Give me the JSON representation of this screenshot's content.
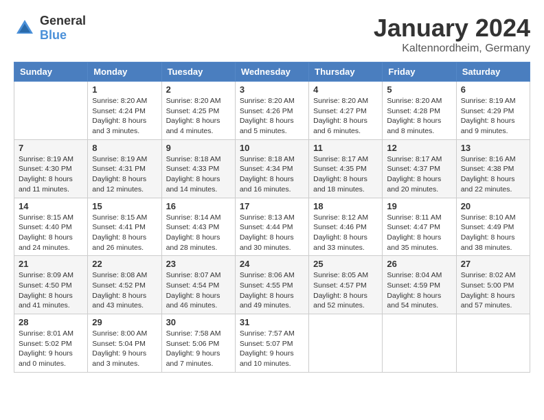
{
  "header": {
    "logo_general": "General",
    "logo_blue": "Blue",
    "month": "January 2024",
    "location": "Kaltennordheim, Germany"
  },
  "days_of_week": [
    "Sunday",
    "Monday",
    "Tuesday",
    "Wednesday",
    "Thursday",
    "Friday",
    "Saturday"
  ],
  "weeks": [
    {
      "shaded": false,
      "days": [
        {
          "number": "",
          "info": ""
        },
        {
          "number": "1",
          "info": "Sunrise: 8:20 AM\nSunset: 4:24 PM\nDaylight: 8 hours\nand 3 minutes."
        },
        {
          "number": "2",
          "info": "Sunrise: 8:20 AM\nSunset: 4:25 PM\nDaylight: 8 hours\nand 4 minutes."
        },
        {
          "number": "3",
          "info": "Sunrise: 8:20 AM\nSunset: 4:26 PM\nDaylight: 8 hours\nand 5 minutes."
        },
        {
          "number": "4",
          "info": "Sunrise: 8:20 AM\nSunset: 4:27 PM\nDaylight: 8 hours\nand 6 minutes."
        },
        {
          "number": "5",
          "info": "Sunrise: 8:20 AM\nSunset: 4:28 PM\nDaylight: 8 hours\nand 8 minutes."
        },
        {
          "number": "6",
          "info": "Sunrise: 8:19 AM\nSunset: 4:29 PM\nDaylight: 8 hours\nand 9 minutes."
        }
      ]
    },
    {
      "shaded": true,
      "days": [
        {
          "number": "7",
          "info": "Sunrise: 8:19 AM\nSunset: 4:30 PM\nDaylight: 8 hours\nand 11 minutes."
        },
        {
          "number": "8",
          "info": "Sunrise: 8:19 AM\nSunset: 4:31 PM\nDaylight: 8 hours\nand 12 minutes."
        },
        {
          "number": "9",
          "info": "Sunrise: 8:18 AM\nSunset: 4:33 PM\nDaylight: 8 hours\nand 14 minutes."
        },
        {
          "number": "10",
          "info": "Sunrise: 8:18 AM\nSunset: 4:34 PM\nDaylight: 8 hours\nand 16 minutes."
        },
        {
          "number": "11",
          "info": "Sunrise: 8:17 AM\nSunset: 4:35 PM\nDaylight: 8 hours\nand 18 minutes."
        },
        {
          "number": "12",
          "info": "Sunrise: 8:17 AM\nSunset: 4:37 PM\nDaylight: 8 hours\nand 20 minutes."
        },
        {
          "number": "13",
          "info": "Sunrise: 8:16 AM\nSunset: 4:38 PM\nDaylight: 8 hours\nand 22 minutes."
        }
      ]
    },
    {
      "shaded": false,
      "days": [
        {
          "number": "14",
          "info": "Sunrise: 8:15 AM\nSunset: 4:40 PM\nDaylight: 8 hours\nand 24 minutes."
        },
        {
          "number": "15",
          "info": "Sunrise: 8:15 AM\nSunset: 4:41 PM\nDaylight: 8 hours\nand 26 minutes."
        },
        {
          "number": "16",
          "info": "Sunrise: 8:14 AM\nSunset: 4:43 PM\nDaylight: 8 hours\nand 28 minutes."
        },
        {
          "number": "17",
          "info": "Sunrise: 8:13 AM\nSunset: 4:44 PM\nDaylight: 8 hours\nand 30 minutes."
        },
        {
          "number": "18",
          "info": "Sunrise: 8:12 AM\nSunset: 4:46 PM\nDaylight: 8 hours\nand 33 minutes."
        },
        {
          "number": "19",
          "info": "Sunrise: 8:11 AM\nSunset: 4:47 PM\nDaylight: 8 hours\nand 35 minutes."
        },
        {
          "number": "20",
          "info": "Sunrise: 8:10 AM\nSunset: 4:49 PM\nDaylight: 8 hours\nand 38 minutes."
        }
      ]
    },
    {
      "shaded": true,
      "days": [
        {
          "number": "21",
          "info": "Sunrise: 8:09 AM\nSunset: 4:50 PM\nDaylight: 8 hours\nand 41 minutes."
        },
        {
          "number": "22",
          "info": "Sunrise: 8:08 AM\nSunset: 4:52 PM\nDaylight: 8 hours\nand 43 minutes."
        },
        {
          "number": "23",
          "info": "Sunrise: 8:07 AM\nSunset: 4:54 PM\nDaylight: 8 hours\nand 46 minutes."
        },
        {
          "number": "24",
          "info": "Sunrise: 8:06 AM\nSunset: 4:55 PM\nDaylight: 8 hours\nand 49 minutes."
        },
        {
          "number": "25",
          "info": "Sunrise: 8:05 AM\nSunset: 4:57 PM\nDaylight: 8 hours\nand 52 minutes."
        },
        {
          "number": "26",
          "info": "Sunrise: 8:04 AM\nSunset: 4:59 PM\nDaylight: 8 hours\nand 54 minutes."
        },
        {
          "number": "27",
          "info": "Sunrise: 8:02 AM\nSunset: 5:00 PM\nDaylight: 8 hours\nand 57 minutes."
        }
      ]
    },
    {
      "shaded": false,
      "days": [
        {
          "number": "28",
          "info": "Sunrise: 8:01 AM\nSunset: 5:02 PM\nDaylight: 9 hours\nand 0 minutes."
        },
        {
          "number": "29",
          "info": "Sunrise: 8:00 AM\nSunset: 5:04 PM\nDaylight: 9 hours\nand 3 minutes."
        },
        {
          "number": "30",
          "info": "Sunrise: 7:58 AM\nSunset: 5:06 PM\nDaylight: 9 hours\nand 7 minutes."
        },
        {
          "number": "31",
          "info": "Sunrise: 7:57 AM\nSunset: 5:07 PM\nDaylight: 9 hours\nand 10 minutes."
        },
        {
          "number": "",
          "info": ""
        },
        {
          "number": "",
          "info": ""
        },
        {
          "number": "",
          "info": ""
        }
      ]
    }
  ]
}
